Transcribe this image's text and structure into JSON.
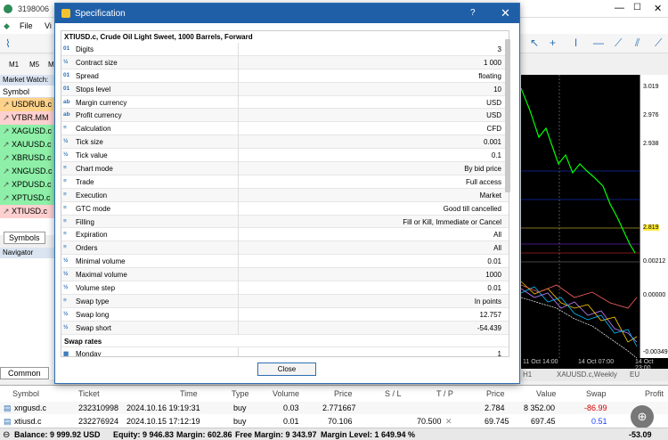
{
  "app": {
    "title": "3198006",
    "menu": [
      "File",
      "Vi"
    ],
    "timeframes": [
      "M1",
      "M5",
      "M"
    ]
  },
  "market_watch": {
    "header": "Market Watch:",
    "column": "Symbol",
    "symbols": [
      {
        "name": "USDRUB.c",
        "color": "#ffd28a"
      },
      {
        "name": "VTBR.MM",
        "color": "#ffd0d0"
      },
      {
        "name": "XAGUSD.c",
        "color": "#8ef0a8"
      },
      {
        "name": "XAUUSD.c",
        "color": "#8ef0a8"
      },
      {
        "name": "XBRUSD.c",
        "color": "#8ef0a8"
      },
      {
        "name": "XNGUSD.c",
        "color": "#8ef0a8"
      },
      {
        "name": "XPDUSD.c",
        "color": "#8ef0a8"
      },
      {
        "name": "XPTUSD.c",
        "color": "#8ef0a8"
      },
      {
        "name": "XTIUSD.c",
        "color": "#ffd0d0"
      }
    ],
    "tab": "Symbols"
  },
  "navigator": {
    "header": "Navigator",
    "tab": "Common"
  },
  "dialog": {
    "title": "Specification",
    "heading": "XTIUSD.c, Crude Oil Light Sweet, 1000 Barrels, Forward",
    "rows": [
      {
        "icon": "01",
        "key": "Digits",
        "value": "3"
      },
      {
        "icon": "½",
        "key": "Contract size",
        "value": "1 000"
      },
      {
        "icon": "01",
        "key": "Spread",
        "value": "floating"
      },
      {
        "icon": "01",
        "key": "Stops level",
        "value": "10"
      },
      {
        "icon": "ab",
        "key": "Margin currency",
        "value": "USD"
      },
      {
        "icon": "ab",
        "key": "Profit currency",
        "value": "USD"
      },
      {
        "icon": "≡",
        "key": "Calculation",
        "value": "CFD"
      },
      {
        "icon": "½",
        "key": "Tick size",
        "value": "0.001"
      },
      {
        "icon": "½",
        "key": "Tick value",
        "value": "0.1"
      },
      {
        "icon": "≡",
        "key": "Chart mode",
        "value": "By bid price"
      },
      {
        "icon": "≡",
        "key": "Trade",
        "value": "Full access"
      },
      {
        "icon": "≡",
        "key": "Execution",
        "value": "Market"
      },
      {
        "icon": "≡",
        "key": "GTC mode",
        "value": "Good till cancelled"
      },
      {
        "icon": "≡",
        "key": "Filling",
        "value": "Fill or Kill, Immediate or Cancel"
      },
      {
        "icon": "≡",
        "key": "Expiration",
        "value": "All"
      },
      {
        "icon": "≡",
        "key": "Orders",
        "value": "All"
      },
      {
        "icon": "½",
        "key": "Minimal volume",
        "value": "0.01"
      },
      {
        "icon": "½",
        "key": "Maximal volume",
        "value": "1000"
      },
      {
        "icon": "½",
        "key": "Volume step",
        "value": "0.01"
      },
      {
        "icon": "≡",
        "key": "Swap type",
        "value": "In points"
      },
      {
        "icon": "½",
        "key": "Swap long",
        "value": "12.757"
      },
      {
        "icon": "½",
        "key": "Swap short",
        "value": "-54.439"
      }
    ],
    "section": "Swap rates",
    "last_row": {
      "icon": "▦",
      "key": "Monday",
      "value": "1"
    },
    "close_label": "Close",
    "help": "?",
    "x": "✕"
  },
  "chart": {
    "scale_labels": [
      "3.019",
      "2.976",
      "2.938",
      "2.819",
      "0.00212",
      "0.00000",
      "-0.00349"
    ],
    "time_labels": [
      "11 Oct 14:00",
      "14 Oct 07:00",
      "14 Oct 23:00"
    ],
    "tabs": [
      "H1",
      "XAUUSD.c,Weekly",
      "EU"
    ]
  },
  "terminal": {
    "headers": [
      "Symbol",
      "Ticket",
      "Time",
      "Type",
      "Volume",
      "Price",
      "S / L",
      "T / P",
      "Price",
      "Value",
      "Swap",
      "Profit"
    ],
    "rows": [
      {
        "symbol": "xngusd.c",
        "ticket": "232310998",
        "time": "2024.10.16 19:19:31",
        "type": "buy",
        "volume": "0.03",
        "price": "2.771667",
        "sl": "",
        "tp": "",
        "cur": "2.784",
        "value": "8 352.00",
        "swap": "-86.99",
        "profit": ""
      },
      {
        "symbol": "xtiusd.c",
        "ticket": "232276924",
        "time": "2024.10.15 17:12:19",
        "type": "buy",
        "volume": "0.01",
        "price": "70.106",
        "sl": "",
        "tp": "70.500",
        "cur": "69.745",
        "value": "697.45",
        "swap": "0.51",
        "profit": ""
      }
    ],
    "status": {
      "balance": "Balance: 9 999.92 USD",
      "equity": "Equity: 9 946.83",
      "margin": "Margin: 602.86",
      "free": "Free Margin: 9 343.97",
      "level": "Margin Level: 1 649.94 %",
      "total": "-53.09"
    }
  }
}
